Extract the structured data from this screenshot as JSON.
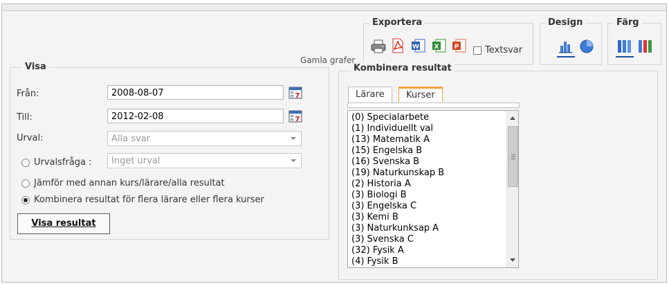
{
  "header": {
    "export_legend": "Exportera",
    "textsvar_label": "Textsvar",
    "design_legend": "Design",
    "farg_legend": "Färg",
    "gamla_grafer": "Gamla grafer"
  },
  "icons": {
    "export": [
      "printer-icon",
      "pdf-icon",
      "word-icon",
      "excel-icon",
      "powerpoint-icon"
    ],
    "design": [
      "bar-chart-icon",
      "pie-chart-icon"
    ],
    "farg": [
      "blue-bars-icon",
      "multicolor-bars-icon"
    ]
  },
  "colors": {
    "accent": "#1a4f9e",
    "active_tab": "#f1a33a"
  },
  "visa": {
    "legend": "Visa",
    "fran_label": "Från:",
    "fran_value": "2008-08-07",
    "till_label": "Till:",
    "till_value": "2012-02-08",
    "urval_label": "Urval:",
    "urval_value": "Alla svar",
    "urvalsfraga_label": "Urvalsfråga :",
    "urvalsfraga_value": "Inget urval",
    "jamfor_label": "Jämför med annan kurs/lärare/alla resultat",
    "kombinera_label": "Kombinera resultat för flera lärare eller flera kurser",
    "button_label": "Visa resultat"
  },
  "kombinera": {
    "legend": "Kombinera resultat",
    "tabs": [
      "Lärare",
      "Kurser"
    ],
    "active_tab": "Kurser",
    "items": [
      "(0) Specialarbete",
      "(1) Individuellt val",
      "(13) Matematik A",
      "(15) Engelska B",
      "(16) Svenska B",
      "(19) Naturkunskap B",
      "(2) Historia A",
      "(3) Biologi B",
      "(3) Engelska C",
      "(3) Kemi B",
      "(3) Naturkunksap A",
      "(3) Svenska C",
      "(32) Fysik A",
      "(4) Fysik B"
    ]
  }
}
